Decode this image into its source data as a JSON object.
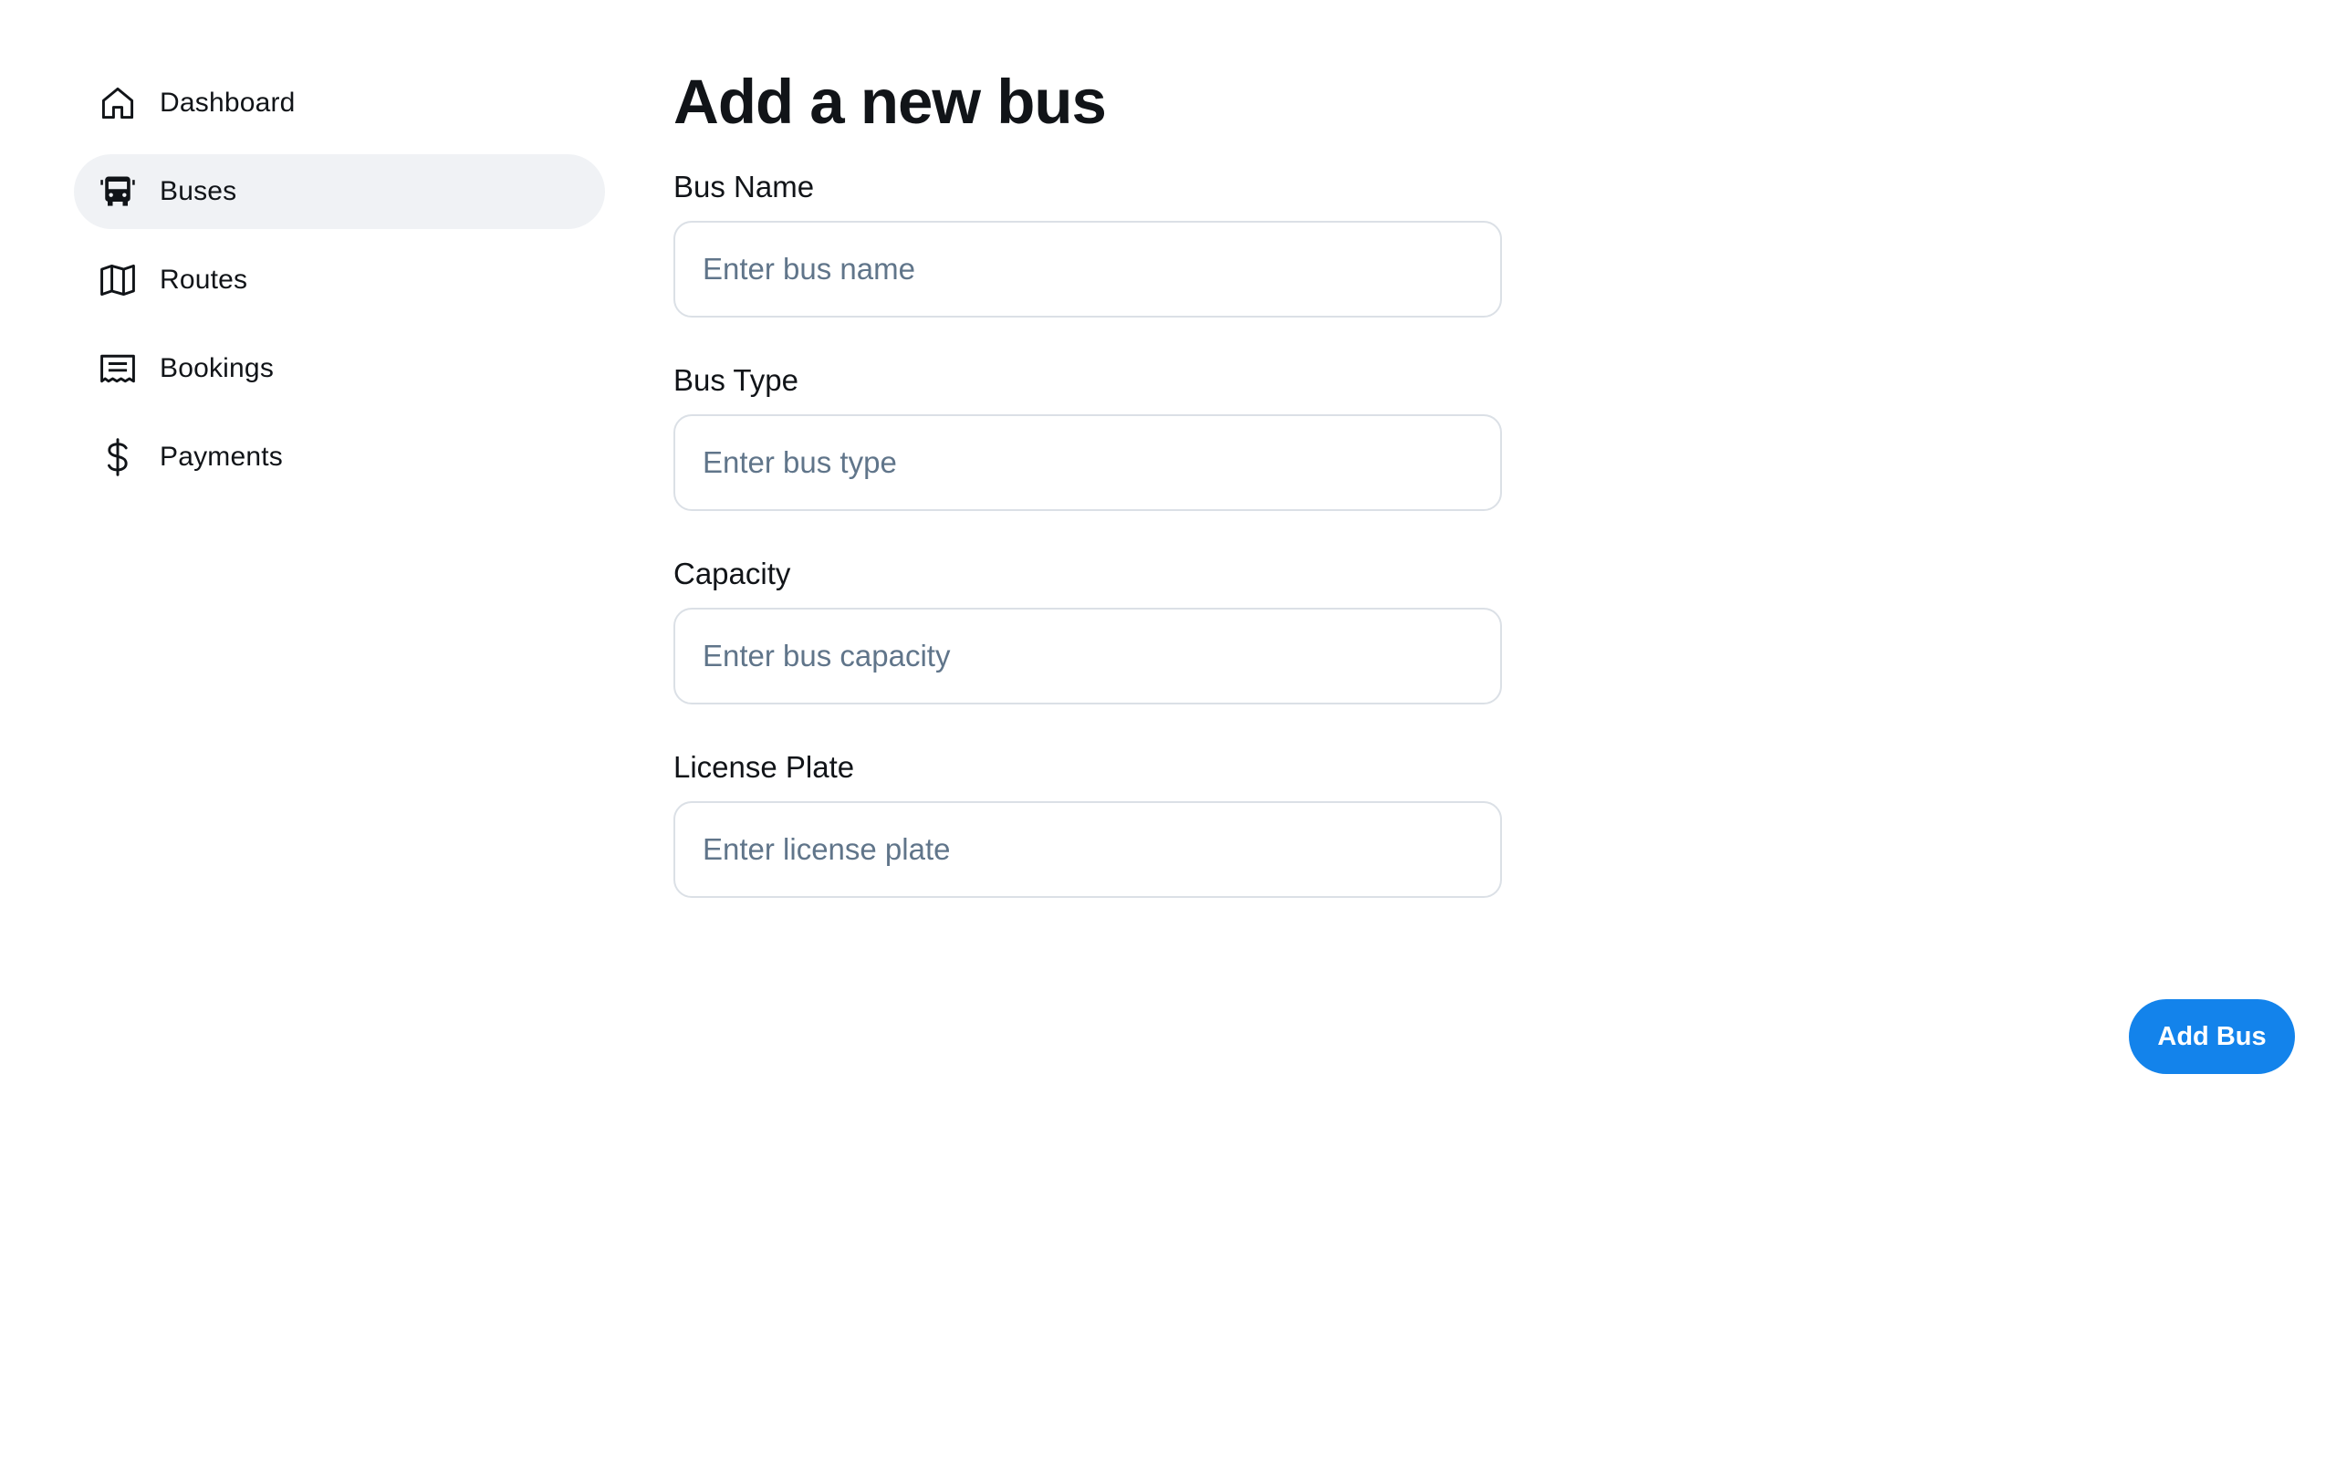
{
  "sidebar": {
    "items": [
      {
        "label": "Dashboard",
        "icon": "house-icon",
        "active": false
      },
      {
        "label": "Buses",
        "icon": "bus-icon",
        "active": true
      },
      {
        "label": "Routes",
        "icon": "map-icon",
        "active": false
      },
      {
        "label": "Bookings",
        "icon": "receipt-icon",
        "active": false
      },
      {
        "label": "Payments",
        "icon": "dollar-icon",
        "active": false
      }
    ]
  },
  "main": {
    "title": "Add a new bus",
    "fields": [
      {
        "label": "Bus Name",
        "placeholder": "Enter bus name",
        "value": ""
      },
      {
        "label": "Bus Type",
        "placeholder": "Enter bus type",
        "value": ""
      },
      {
        "label": "Capacity",
        "placeholder": "Enter bus capacity",
        "value": ""
      },
      {
        "label": "License Plate",
        "placeholder": "Enter license plate",
        "value": ""
      }
    ],
    "submit_label": "Add Bus"
  },
  "colors": {
    "accent": "#1383eb",
    "active_bg": "#f0f2f5",
    "border": "#dbe0e6",
    "placeholder": "#60758a",
    "text": "#111418"
  }
}
